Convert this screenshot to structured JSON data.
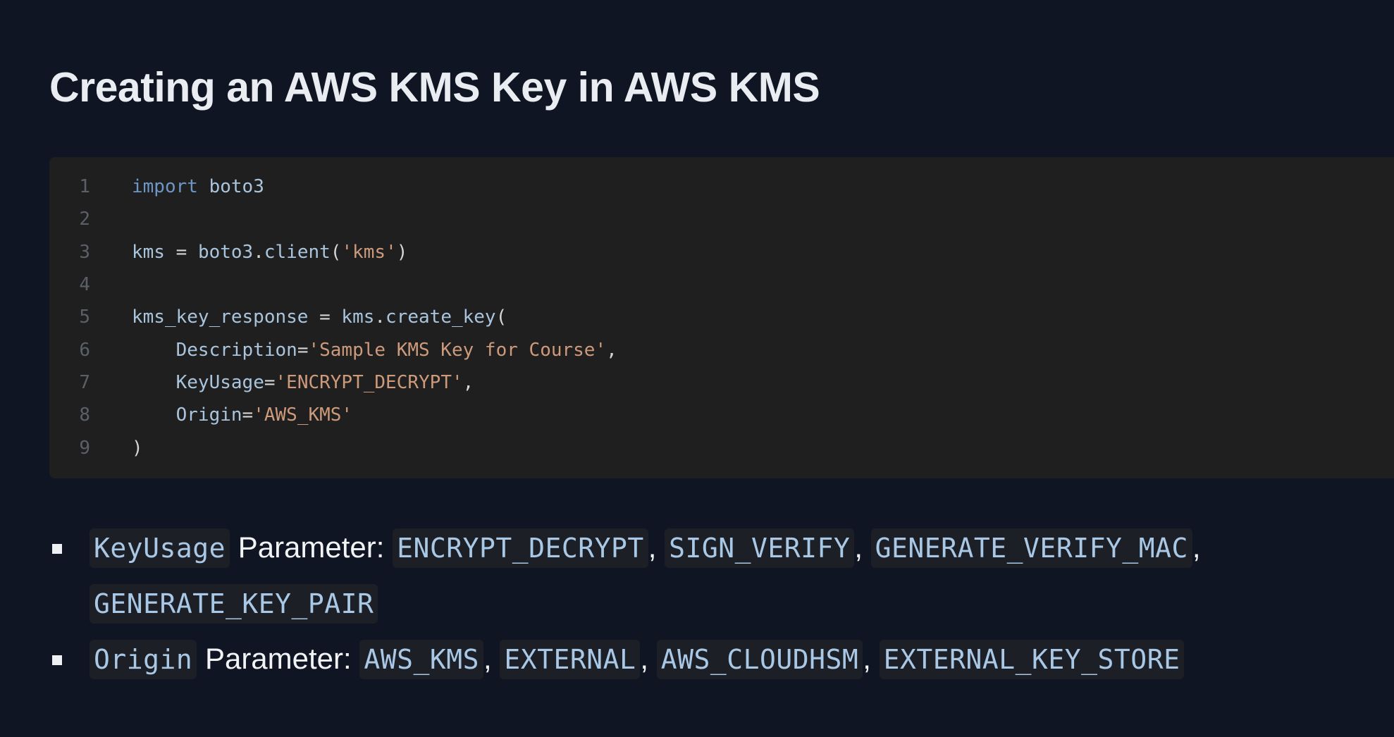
{
  "title": "Creating an AWS KMS Key in AWS KMS",
  "code": {
    "line_numbers": [
      "1",
      "2",
      "3",
      "4",
      "5",
      "6",
      "7",
      "8",
      "9"
    ],
    "l1": {
      "kw": "import",
      "mod": "boto3"
    },
    "l3": {
      "var": "kms",
      "eq": " = ",
      "mod": "boto3",
      "dot": ".",
      "fn": "client",
      "open": "(",
      "str": "'kms'",
      "close": ")"
    },
    "l5": {
      "var": "kms_key_response",
      "eq": " = ",
      "obj": "kms",
      "dot": ".",
      "fn": "create_key",
      "open": "("
    },
    "l6": {
      "param": "Description",
      "eq": "=",
      "str": "'Sample KMS Key for Course'",
      "comma": ","
    },
    "l7": {
      "param": "KeyUsage",
      "eq": "=",
      "str": "'ENCRYPT_DECRYPT'",
      "comma": ","
    },
    "l8": {
      "param": "Origin",
      "eq": "=",
      "str": "'AWS_KMS'"
    },
    "l9": {
      "close": ")"
    }
  },
  "bullets": {
    "keyusage": {
      "name": "KeyUsage",
      "label": " Parameter: ",
      "values": [
        "ENCRYPT_DECRYPT",
        "SIGN_VERIFY",
        "GENERATE_VERIFY_MAC",
        "GENERATE_KEY_PAIR"
      ],
      "separator": ", "
    },
    "origin": {
      "name": "Origin",
      "label": " Parameter: ",
      "values": [
        "AWS_KMS",
        "EXTERNAL",
        "AWS_CLOUDHSM",
        "EXTERNAL_KEY_STORE"
      ],
      "separator": ", "
    }
  }
}
